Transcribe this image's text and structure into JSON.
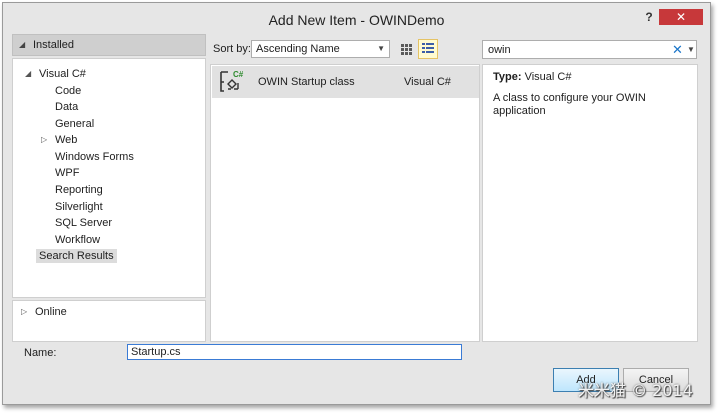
{
  "window": {
    "title": "Add New Item - OWINDemo",
    "help_label": "?",
    "close_label": "✕"
  },
  "left_panel": {
    "installed_label": "Installed",
    "tree_root": "Visual C#",
    "tree_items": [
      {
        "label": "Code",
        "expandable": false
      },
      {
        "label": "Data",
        "expandable": false
      },
      {
        "label": "General",
        "expandable": false
      },
      {
        "label": "Web",
        "expandable": true
      },
      {
        "label": "Windows Forms",
        "expandable": false
      },
      {
        "label": "WPF",
        "expandable": false
      },
      {
        "label": "Reporting",
        "expandable": false
      },
      {
        "label": "Silverlight",
        "expandable": false
      },
      {
        "label": "SQL Server",
        "expandable": false
      },
      {
        "label": "Workflow",
        "expandable": false
      }
    ],
    "search_results_label": "Search Results",
    "online_label": "Online"
  },
  "toolbar": {
    "sort_label": "Sort by:",
    "sort_value": "Ascending Name",
    "search_value": "owin"
  },
  "items": [
    {
      "name": "OWIN Startup class",
      "language": "Visual C#",
      "icon": "csharp-class-icon"
    }
  ],
  "details": {
    "type_label": "Type:",
    "type_value": "Visual C#",
    "description": "A class to configure your OWIN application"
  },
  "bottom": {
    "name_label": "Name:",
    "name_value": "Startup.cs",
    "add_label": "Add",
    "cancel_label": "Cancel",
    "watermark": "米米猫 © 2014"
  },
  "colors": {
    "close_button": "#c7383a",
    "selected_row": "#e1e1e1",
    "focus_border": "#3a7bd5",
    "clear_icon": "#1a75c9"
  }
}
